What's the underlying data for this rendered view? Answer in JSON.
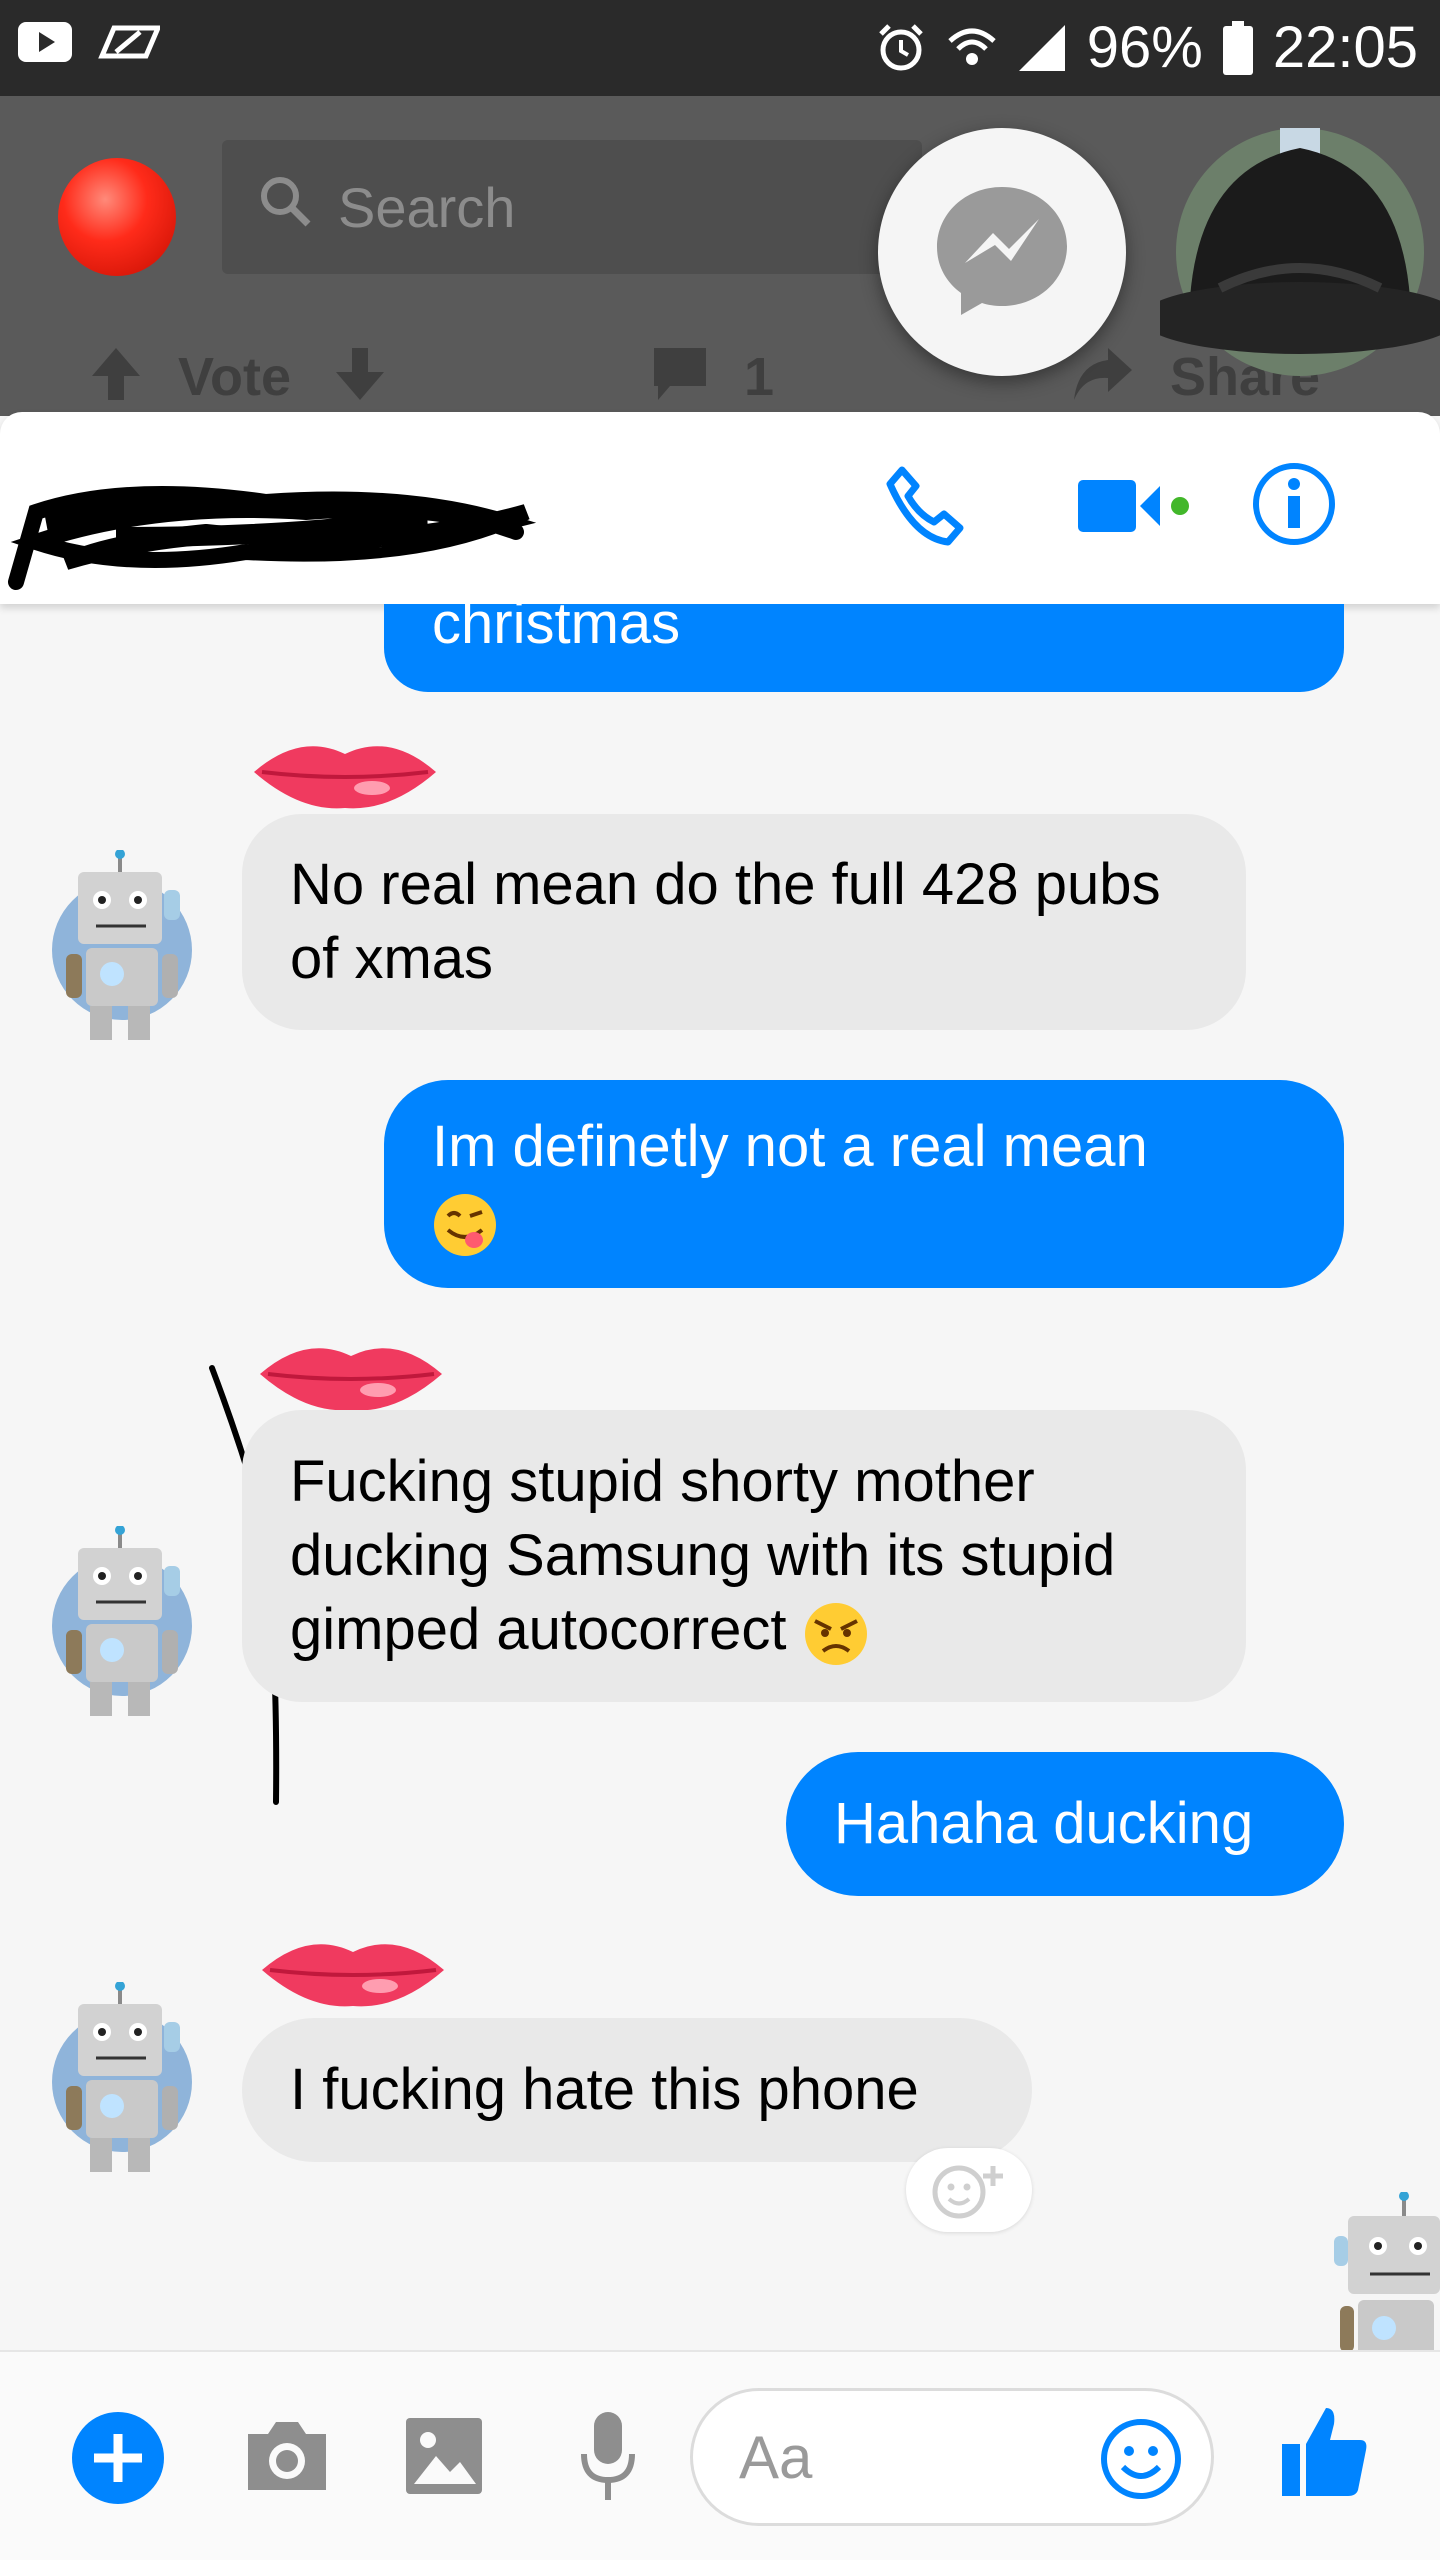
{
  "status_bar": {
    "battery": "96%",
    "time": "22:05",
    "left_icons": [
      "youtube-icon",
      "nfs-icon"
    ],
    "right_icons": [
      "alarm-icon",
      "wifi-icon",
      "signal-icon",
      "battery-icon"
    ]
  },
  "background_app": {
    "search_placeholder": "Search",
    "vote_label": "Vote",
    "comment_count": "1",
    "share_label": "Share"
  },
  "chat_header": {
    "contact_name_redacted": true,
    "active_dot_color": "#42b72a"
  },
  "messages": [
    {
      "direction": "out",
      "text": "christmas"
    },
    {
      "direction": "in",
      "text": "No real mean do the full 428 pubs of xmas"
    },
    {
      "direction": "out",
      "text": "Im definetly not a real mean",
      "emoji": "savoring-face"
    },
    {
      "direction": "in",
      "text": "Fucking stupid shorty mother ducking Samsung with its stupid gimped autocorrect",
      "emoji": "angry-face"
    },
    {
      "direction": "out",
      "text": "Hahaha ducking"
    },
    {
      "direction": "in",
      "text": "I fucking hate this phone"
    }
  ],
  "composer": {
    "placeholder": "Aa"
  },
  "colors": {
    "messenger_blue": "#0084ff",
    "incoming_bubble": "#e9e9e9",
    "status_bar": "#2a2a2a"
  }
}
